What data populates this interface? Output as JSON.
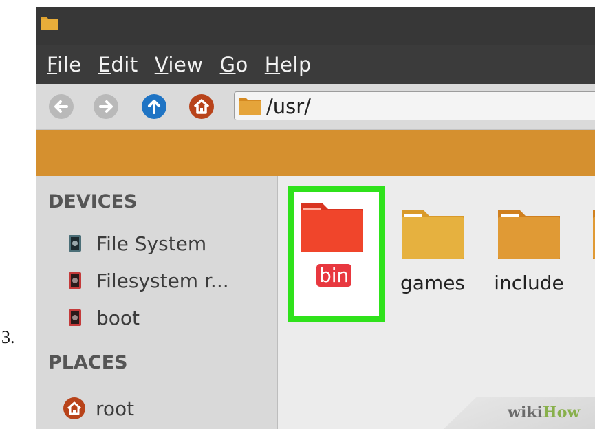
{
  "step": {
    "number": "3."
  },
  "menubar": {
    "items": [
      "File",
      "Edit",
      "View",
      "Go",
      "Help"
    ]
  },
  "toolbar": {
    "back_icon": "arrow-left-icon",
    "forward_icon": "arrow-right-icon",
    "up_icon": "arrow-up-icon",
    "home_icon": "home-icon",
    "address": "/usr/"
  },
  "sidebar": {
    "devices_header": "DEVICES",
    "devices": [
      {
        "label": "File System",
        "icon": "drive-icon"
      },
      {
        "label": "Filesystem r...",
        "icon": "drive-icon"
      },
      {
        "label": "boot",
        "icon": "drive-icon"
      }
    ],
    "places_header": "PLACES",
    "places": [
      {
        "label": "root",
        "icon": "home-icon"
      }
    ]
  },
  "content": {
    "items": [
      {
        "label": "bin",
        "selected": true,
        "color": "#e8452a"
      },
      {
        "label": "games",
        "selected": false,
        "color": "#e0a32f"
      },
      {
        "label": "include",
        "selected": false,
        "color": "#dc8d2a"
      }
    ]
  },
  "watermark": {
    "wiki": "wiki",
    "how": "How"
  },
  "colors": {
    "accent_orange": "#d5902f",
    "selection_green": "#2fe21b",
    "selection_label_red": "#e8383f",
    "up_button_blue": "#1f74c4",
    "home_button_red": "#b8431a"
  }
}
